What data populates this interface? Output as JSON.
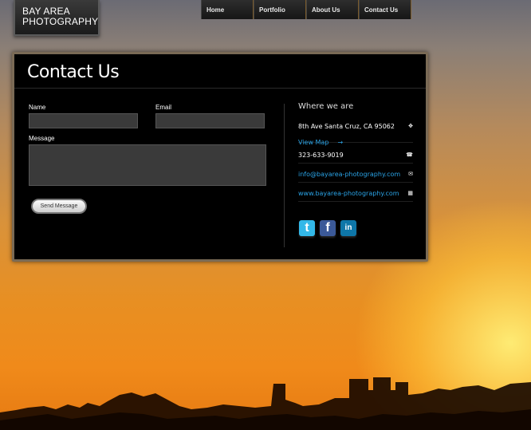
{
  "logo": {
    "line1": "BAY AREA",
    "line2": "PHOTOGRAPHY"
  },
  "nav": [
    {
      "label": "Home"
    },
    {
      "label": "Portfolio"
    },
    {
      "label": "About Us"
    },
    {
      "label": "Contact Us"
    }
  ],
  "contact": {
    "title": "Contact Us",
    "name_label": "Name",
    "email_label": "Email",
    "message_label": "Message",
    "send_label": "Send Message"
  },
  "where": {
    "title": "Where we are",
    "address": "8th Ave Santa Cruz, CA 95062",
    "map_link": "View Map",
    "map_arrow": "→",
    "phone": "323-633-9019",
    "email": "info@bayarea-photography.com",
    "website": "www.bayarea-photography.com"
  },
  "social": [
    {
      "name": "twitter",
      "glyph": "t",
      "color": "#33b8e8"
    },
    {
      "name": "facebook",
      "glyph": "f",
      "color": "#3b5998"
    },
    {
      "name": "linkedin",
      "glyph": "in",
      "color": "#0e76a8"
    }
  ]
}
